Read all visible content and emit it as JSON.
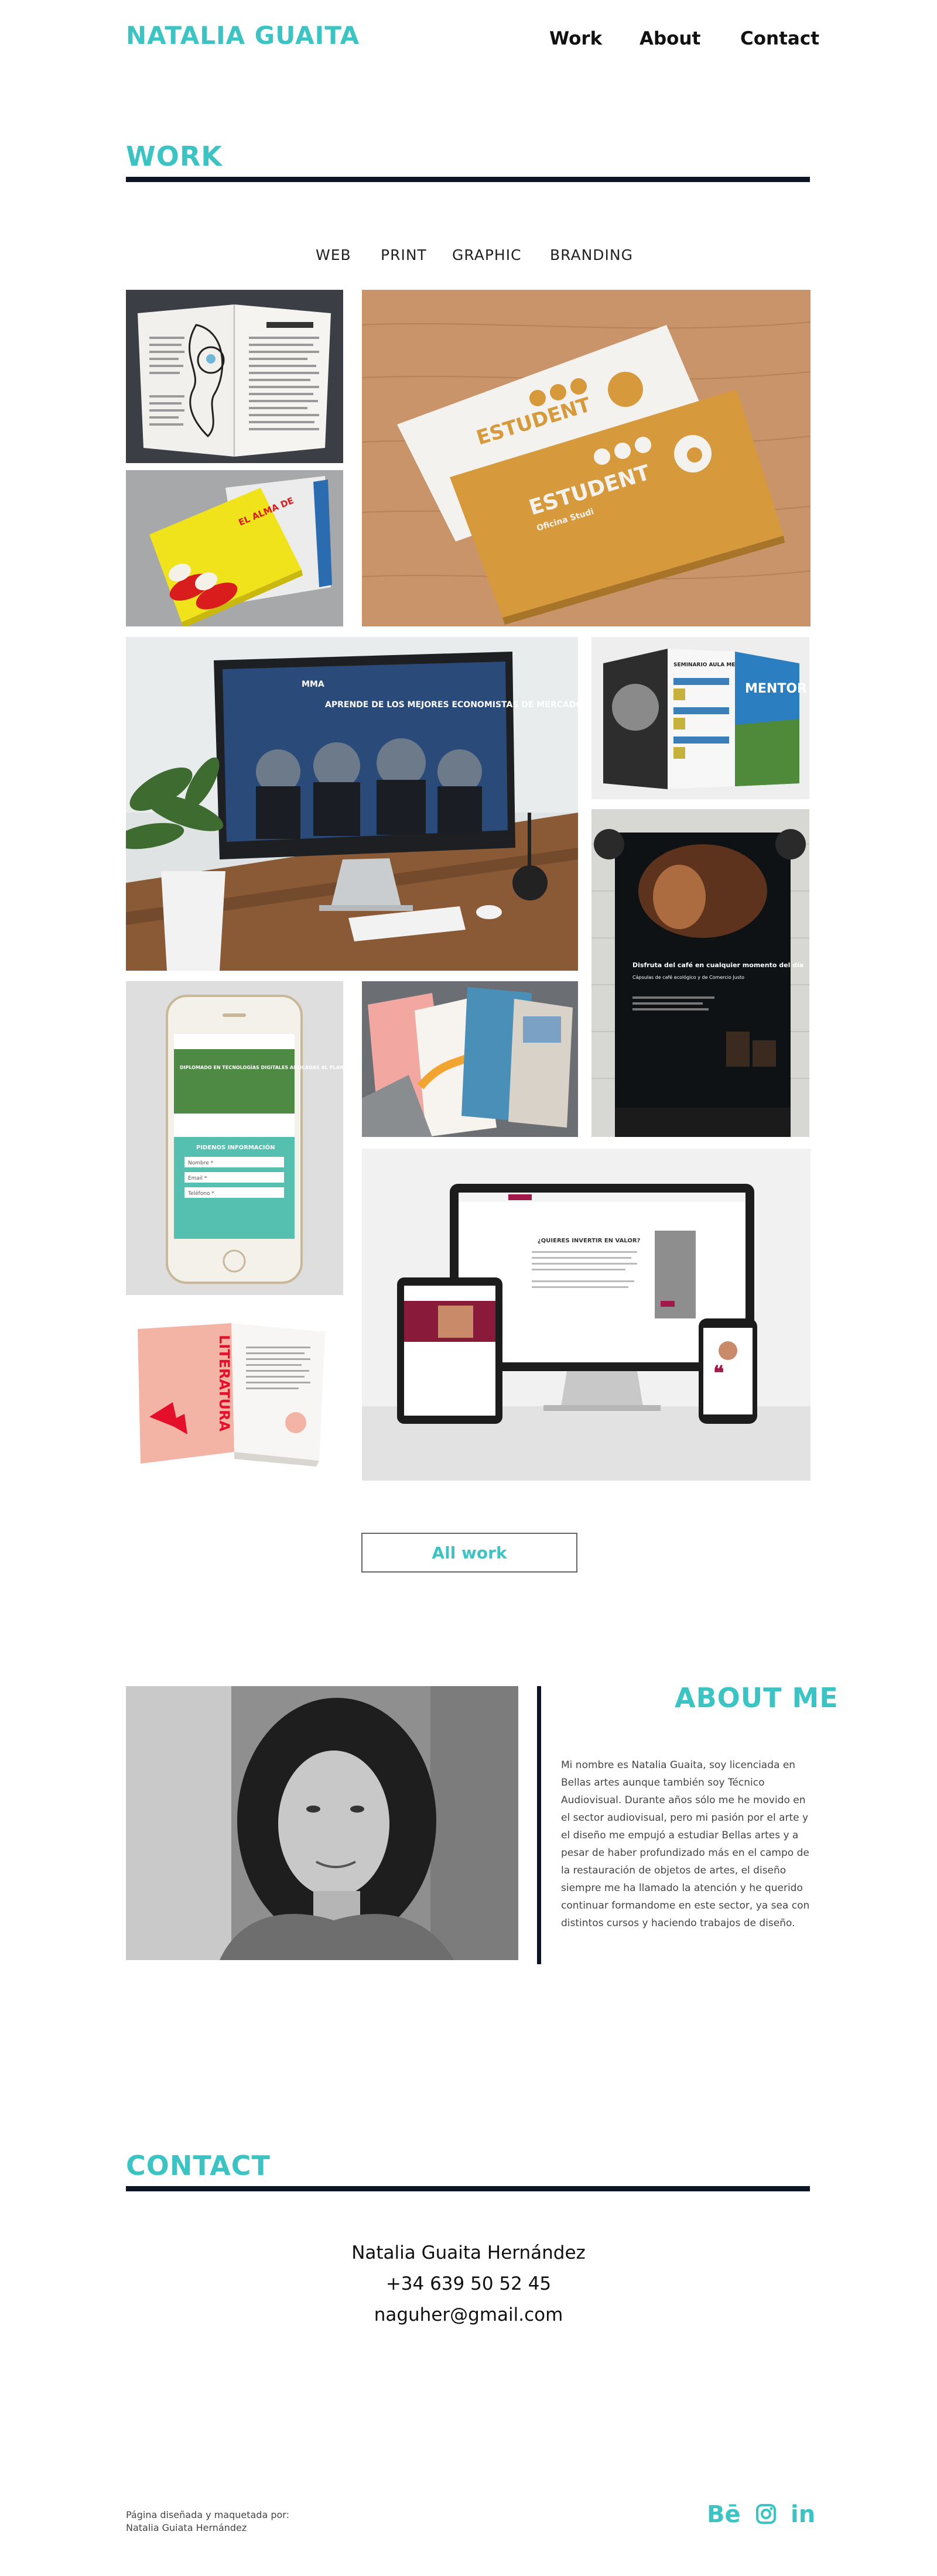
{
  "header": {
    "logo": "NATALIA GUAITA",
    "nav": {
      "work": "Work",
      "about": "About",
      "contact": "Contact"
    }
  },
  "work": {
    "title": "WORK",
    "filters": [
      "WEB",
      "PRINT",
      "GRAPHIC",
      "BRANDING"
    ],
    "tiles": {
      "estudent": {
        "brand": "ESTUDENT",
        "tagline": "Oficina Studi"
      },
      "imac": {
        "brand": "MMA",
        "headline": "APRENDE DE LOS MEJORES ECONOMISTAS DE MERCADO"
      },
      "brochure": {
        "brand": "MENTOR",
        "headline": "SEMINARIO AULA MENTOR"
      },
      "poster": {
        "headline": "Disfruta del café en cualquier momento del día",
        "sub": "Cápsulas de café ecológico y de Comercio Justo"
      },
      "phone": {
        "headline": "DIPLOMADO EN TECNOLOGÍAS DIGITALES APLICADAS AL PLANEAMIENTO Y AL DISEÑO URBANO (BIM & GIS)",
        "form_title": "PIDENOS INFORMACIÓN",
        "f1": "Nombre *",
        "f2": "Email *",
        "f3": "Teléfono *"
      },
      "devices": {
        "headline": "¿QUIERES INVERTIR EN VALOR?"
      },
      "literatura": {
        "word": "LITERATURA"
      },
      "libro": {
        "word": "EL ALMA DE"
      }
    },
    "all_work": "All work"
  },
  "about": {
    "title": "ABOUT ME",
    "bio": "Mi nombre es Natalia Guaita, soy licenciada en Bellas artes aunque también soy Técnico Audiovisual. Durante años sólo me he movido en el sector audiovisual, pero mi pasión por el arte y el diseño me empujó a estudiar Bellas artes y a pesar de haber profundizado más en el campo de la restauración de objetos de artes, el diseño siempre me ha llamado la atención y he querido continuar formandome en este sector, ya sea con distintos cursos y haciendo trabajos de diseño."
  },
  "contact": {
    "title": "CONTACT",
    "name": "Natalia Guaita Hernández",
    "phone": "+34  639 50 52 45",
    "email": "naguher@gmail.com"
  },
  "footer": {
    "credit_1": "Página diseñada y maquetada por:",
    "credit_2": "Natalia Guiata Hernández",
    "social": [
      "behance-icon",
      "instagram-icon",
      "linkedin-icon"
    ]
  },
  "colors": {
    "accent": "#3cc3c3",
    "rule": "#0d1424"
  }
}
